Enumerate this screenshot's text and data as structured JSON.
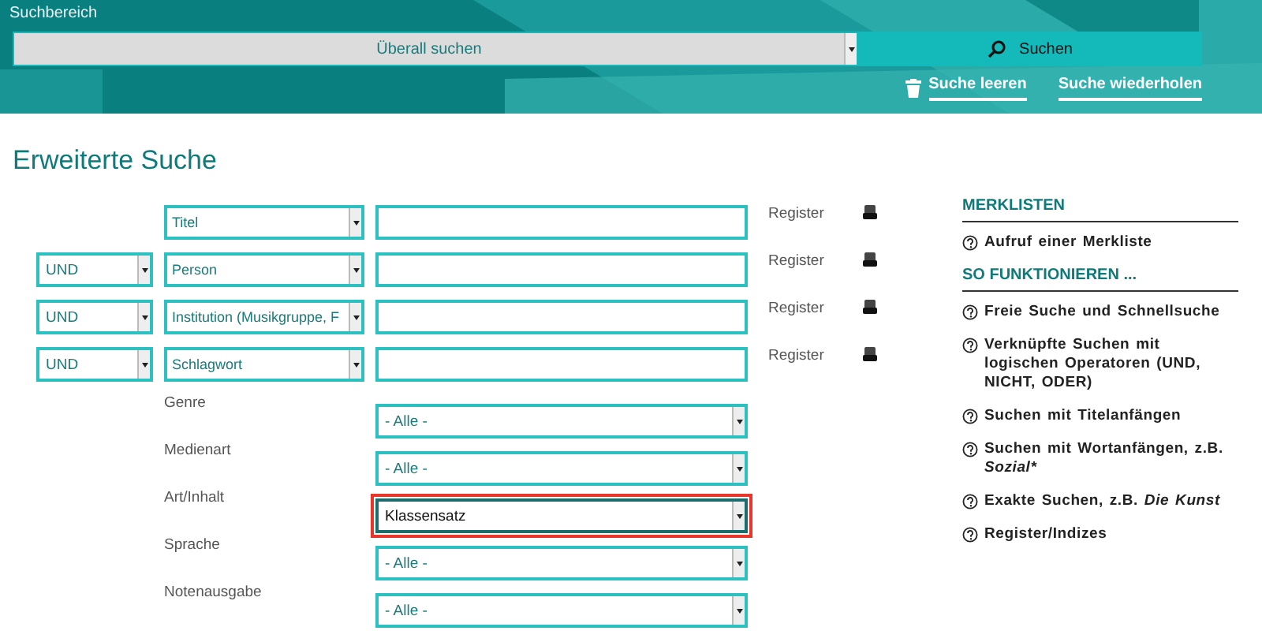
{
  "header": {
    "title": "Suchbereich",
    "scope_select": {
      "value": "Überall suchen"
    },
    "search_button": "Suchen",
    "actions": [
      {
        "kind": "clear",
        "label": "Suche leeren"
      },
      {
        "kind": "repeat",
        "label": "Suche wiederholen"
      }
    ]
  },
  "page_title": "Erweiterte Suche",
  "search_rows": [
    {
      "field": "Titel",
      "register": "Register"
    },
    {
      "operator": "UND",
      "field": "Person",
      "register": "Register"
    },
    {
      "operator": "UND",
      "field": "Institution (Musikgruppe, F",
      "register": "Register"
    },
    {
      "operator": "UND",
      "field": "Schlagwort",
      "register": "Register"
    }
  ],
  "filters": [
    {
      "label": "Genre",
      "value": "- Alle -",
      "highlighted": false
    },
    {
      "label": "Medienart",
      "value": "- Alle -",
      "highlighted": false
    },
    {
      "label": "Art/Inhalt",
      "value": "Klassensatz",
      "highlighted": true
    },
    {
      "label": "Sprache",
      "value": "- Alle -",
      "highlighted": false
    },
    {
      "label": "Notenausgabe",
      "value": "- Alle -",
      "highlighted": false
    }
  ],
  "sidebar": [
    {
      "heading": "MERKLISTEN",
      "links": [
        {
          "text": "Aufruf einer Merkliste"
        }
      ]
    },
    {
      "heading": "SO FUNKTIONIEREN ...",
      "links": [
        {
          "text": "Freie Suche und Schnellsuche"
        },
        {
          "text": "Verknüpfte Suchen mit logischen Operatoren (UND, NICHT, ODER)"
        },
        {
          "text": "Suchen mit Titelanfängen"
        },
        {
          "text": "Suchen mit Wortanfängen, z.B.",
          "example": "Sozial*"
        },
        {
          "text": "Exakte Suchen, z.B.",
          "example": "Die Kunst"
        },
        {
          "text": "Register/Indizes"
        }
      ]
    }
  ]
}
